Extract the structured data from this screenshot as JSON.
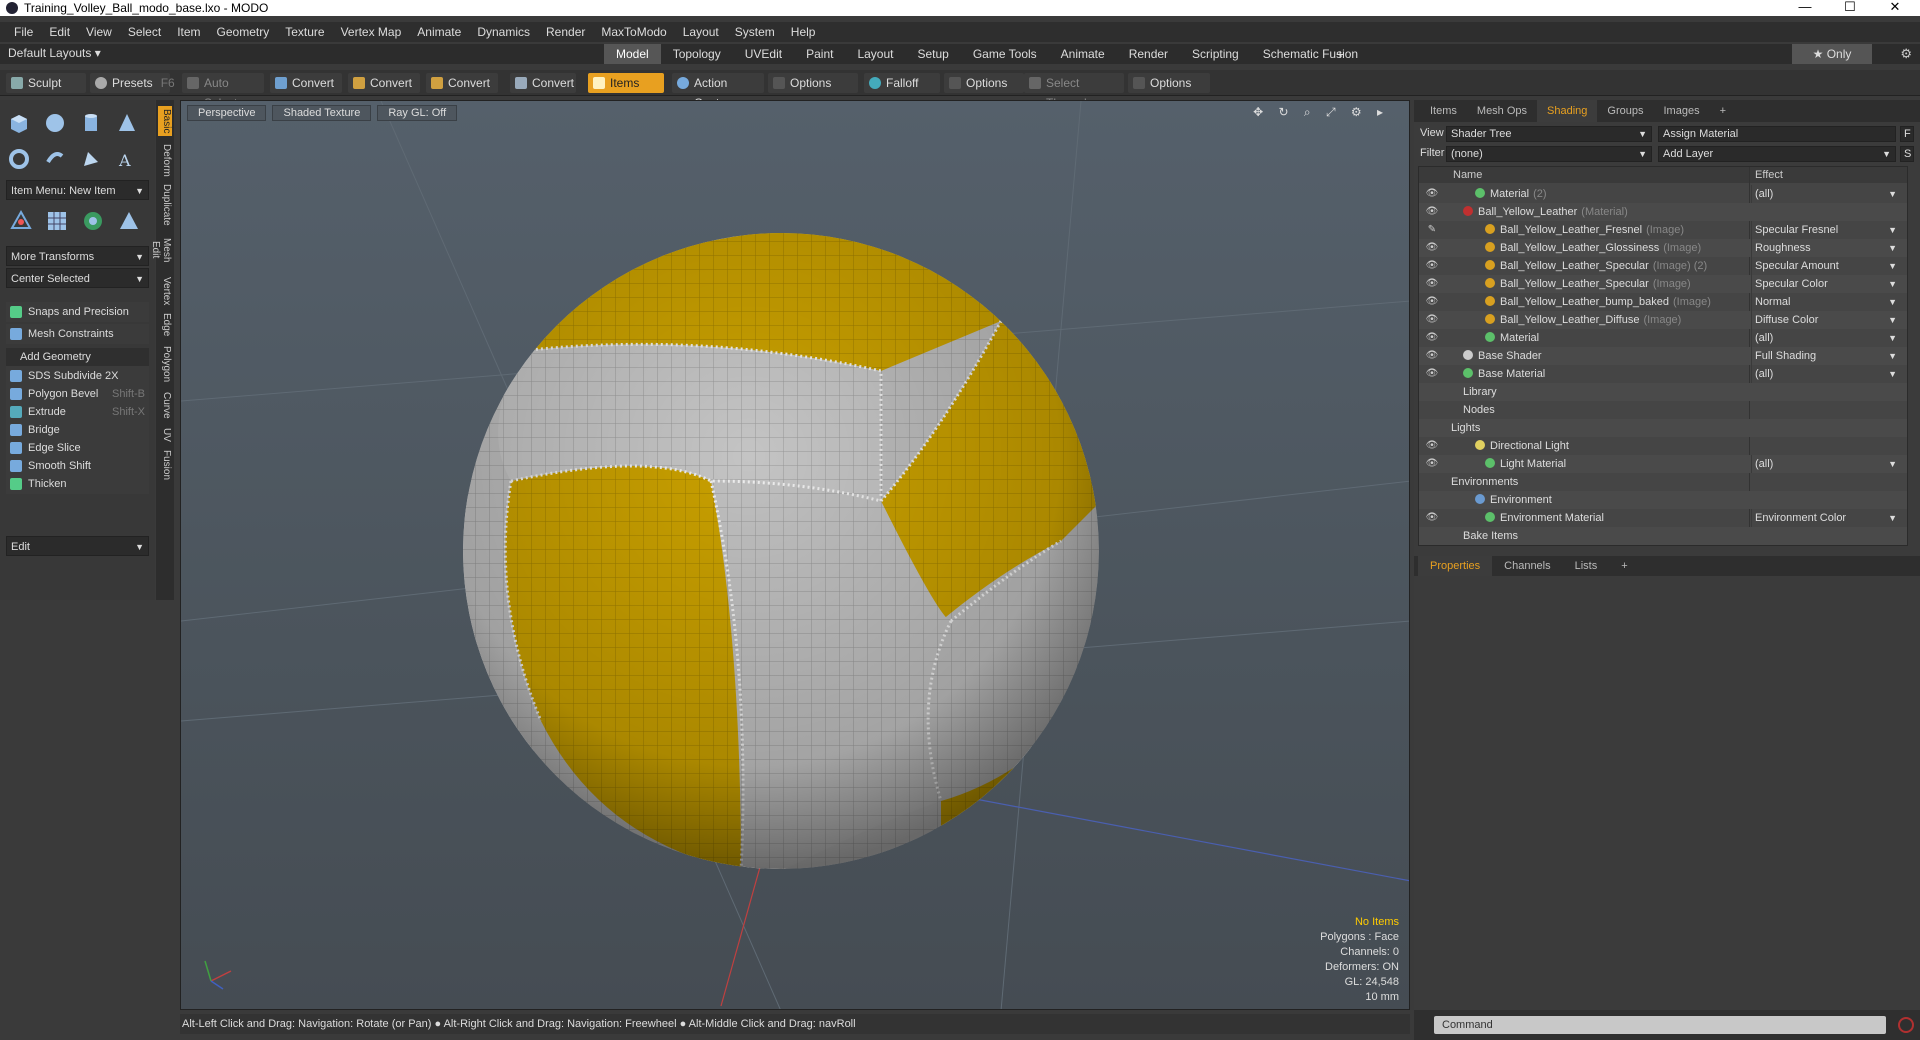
{
  "window": {
    "title": "Training_Volley_Ball_modo_base.lxo - MODO",
    "minimize": "—",
    "maximize": "☐",
    "close": "✕"
  },
  "menu": [
    "File",
    "Edit",
    "View",
    "Select",
    "Item",
    "Geometry",
    "Texture",
    "Vertex Map",
    "Animate",
    "Dynamics",
    "Render",
    "MaxToModo",
    "Layout",
    "System",
    "Help"
  ],
  "layout": {
    "default_layouts": "Default Layouts ▾",
    "tabs": [
      "Model",
      "Topology",
      "UVEdit",
      "Paint",
      "Layout",
      "Setup",
      "Game Tools",
      "Animate",
      "Render",
      "Scripting",
      "Schematic Fusion"
    ],
    "active_tab": "Model",
    "plus": "+",
    "only": "★ Only",
    "gear": "⚙"
  },
  "toolbar": {
    "sculpt": "Sculpt",
    "presets": "Presets",
    "presets_key": "F6",
    "auto_select": "Auto Select",
    "convert1": "Convert",
    "convert2": "Convert",
    "convert3": "Convert",
    "convert4": "Convert",
    "items": "Items",
    "action_center": "Action Center",
    "options1": "Options",
    "falloff": "Falloff",
    "options2": "Options",
    "select_through": "Select Through",
    "options3": "Options"
  },
  "left": {
    "item_menu": "Item Menu: New Item",
    "more_transforms": "More Transforms",
    "center_selected": "Center Selected",
    "snaps": "Snaps and Precision",
    "mesh_constraints": "Mesh Constraints",
    "add_geometry": "Add Geometry",
    "tools": [
      {
        "label": "SDS Subdivide 2X",
        "key": ""
      },
      {
        "label": "Polygon Bevel",
        "key": "Shift-B"
      },
      {
        "label": "Extrude",
        "key": "Shift-X"
      },
      {
        "label": "Bridge",
        "key": ""
      },
      {
        "label": "Edge Slice",
        "key": ""
      },
      {
        "label": "Smooth Shift",
        "key": ""
      },
      {
        "label": "Thicken",
        "key": ""
      }
    ],
    "edit": "Edit",
    "sidetabs": [
      "Basic",
      "Deform",
      "Duplicate",
      "Mesh Edit",
      "Vertex",
      "Edge",
      "Polygon",
      "Curve",
      "UV",
      "Fusion"
    ]
  },
  "viewport": {
    "perspective": "Perspective",
    "shading": "Shaded Texture",
    "raygl": "Ray GL: Off",
    "icons": "✥ ↻ ⌕ ⤢ ⚙ ▸",
    "stats": {
      "no_items": "No Items",
      "polygons": "Polygons : Face",
      "channels": "Channels: 0",
      "deformers": "Deformers: ON",
      "gl": "GL: 24,548",
      "scale": "10 mm"
    }
  },
  "status": "Alt-Left Click and Drag: Navigation: Rotate (or Pan) ● Alt-Right Click and Drag: Navigation: Freewheel ● Alt-Middle Click and Drag: navRoll",
  "right": {
    "tabs": [
      "Items",
      "Mesh Ops",
      "Shading",
      "Groups",
      "Images"
    ],
    "active_tab": "Shading",
    "plus": "+",
    "view_label": "View",
    "view_value": "Shader Tree",
    "assign_material": "Assign Material",
    "f_btn": "F",
    "filter_label": "Filter",
    "filter_value": "(none)",
    "add_layer": "Add Layer",
    "s_btn": "S",
    "col_name": "Name",
    "col_effect": "Effect",
    "tree": [
      {
        "name": "Material",
        "suffix": "(2)",
        "effect": "(all)",
        "indent": 56,
        "eye": "👁",
        "color": "#5cc06a"
      },
      {
        "name": "Ball_Yellow_Leather",
        "suffix": "(Material)",
        "effect": "",
        "indent": 44,
        "eye": "👁",
        "color": "#c03030"
      },
      {
        "name": "Ball_Yellow_Leather_Fresnel",
        "suffix": "(Image)",
        "effect": "Specular Fresnel",
        "indent": 66,
        "eye": "✎",
        "color": "#d8a020"
      },
      {
        "name": "Ball_Yellow_Leather_Glossiness",
        "suffix": "(Image)",
        "effect": "Roughness",
        "indent": 66,
        "eye": "👁",
        "color": "#d8a020"
      },
      {
        "name": "Ball_Yellow_Leather_Specular",
        "suffix": "(Image) (2)",
        "effect": "Specular Amount",
        "indent": 66,
        "eye": "👁",
        "color": "#d8a020"
      },
      {
        "name": "Ball_Yellow_Leather_Specular",
        "suffix": "(Image)",
        "effect": "Specular Color",
        "indent": 66,
        "eye": "👁",
        "color": "#d8a020"
      },
      {
        "name": "Ball_Yellow_Leather_bump_baked",
        "suffix": "(Image)",
        "effect": "Normal",
        "indent": 66,
        "eye": "👁",
        "color": "#d8a020"
      },
      {
        "name": "Ball_Yellow_Leather_Diffuse",
        "suffix": "(Image)",
        "effect": "Diffuse Color",
        "indent": 66,
        "eye": "👁",
        "color": "#d8a020"
      },
      {
        "name": "Material",
        "suffix": "",
        "effect": "(all)",
        "indent": 66,
        "eye": "👁",
        "color": "#5cc06a"
      },
      {
        "name": "Base Shader",
        "suffix": "",
        "effect": "Full Shading",
        "indent": 44,
        "eye": "👁",
        "color": "#cccccc"
      },
      {
        "name": "Base Material",
        "suffix": "",
        "effect": "(all)",
        "indent": 44,
        "eye": "👁",
        "color": "#5cc06a"
      },
      {
        "name": "Library",
        "suffix": "",
        "effect": "",
        "indent": 44,
        "eye": "",
        "color": ""
      },
      {
        "name": "Nodes",
        "suffix": "",
        "effect": "",
        "indent": 44,
        "eye": "",
        "color": ""
      },
      {
        "name": "Lights",
        "suffix": "",
        "effect": "",
        "indent": 32,
        "eye": "",
        "color": ""
      },
      {
        "name": "Directional Light",
        "suffix": "",
        "effect": "",
        "indent": 56,
        "eye": "👁",
        "color": "#e0d060"
      },
      {
        "name": "Light Material",
        "suffix": "",
        "effect": "(all)",
        "indent": 66,
        "eye": "👁",
        "color": "#5cc06a"
      },
      {
        "name": "Environments",
        "suffix": "",
        "effect": "",
        "indent": 32,
        "eye": "",
        "color": ""
      },
      {
        "name": "Environment",
        "suffix": "",
        "effect": "",
        "indent": 56,
        "eye": "",
        "color": "#6a9ad0"
      },
      {
        "name": "Environment Material",
        "suffix": "",
        "effect": "Environment Color",
        "indent": 66,
        "eye": "👁",
        "color": "#5cc06a"
      },
      {
        "name": "Bake Items",
        "suffix": "",
        "effect": "",
        "indent": 44,
        "eye": "",
        "color": ""
      }
    ],
    "prop_tabs": [
      "Properties",
      "Channels",
      "Lists"
    ],
    "prop_active": "Properties",
    "command_placeholder": "Command"
  },
  "colors": {
    "accent": "#e8a020",
    "ball_yellow": "#c9a000",
    "ball_white": "#bdbdbd"
  }
}
